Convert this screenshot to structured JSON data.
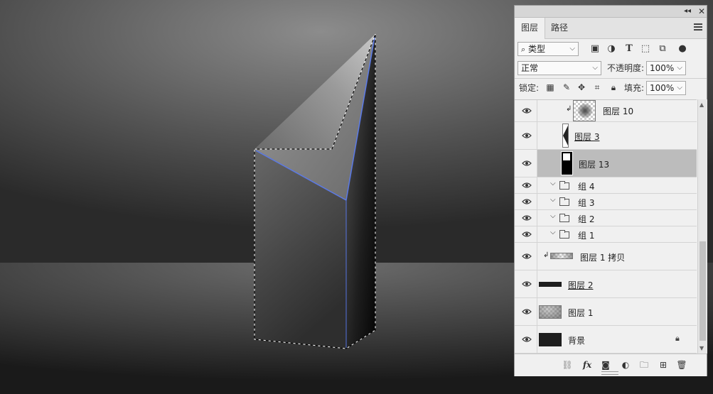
{
  "panel": {
    "tabs": [
      {
        "label": "图层",
        "active": true
      },
      {
        "label": "路径",
        "active": false
      }
    ],
    "titlebar": {
      "collapse_icon": "double-chevron-icon",
      "close_icon": "close-icon"
    },
    "filter": {
      "kind_label": "类型",
      "search_icon": "search-icon"
    },
    "blend": {
      "mode": "正常",
      "opacity_label": "不透明度:",
      "opacity_value": "100%"
    },
    "lock": {
      "label": "锁定:",
      "fill_label": "填充:",
      "fill_value": "100%"
    },
    "layers": [
      {
        "name": "图层 10",
        "kind": "clipped"
      },
      {
        "name": "图层 3",
        "kind": "shape"
      },
      {
        "name": "图层 13",
        "kind": "selected"
      },
      {
        "name": "组 4",
        "kind": "group"
      },
      {
        "name": "组 3",
        "kind": "group"
      },
      {
        "name": "组 2",
        "kind": "group"
      },
      {
        "name": "组 1",
        "kind": "group"
      },
      {
        "name": "图层 1 拷贝",
        "kind": "clipped"
      },
      {
        "name": "图层 2",
        "kind": "bar"
      },
      {
        "name": "图层 1",
        "kind": "checker"
      },
      {
        "name": "背景",
        "kind": "background",
        "locked": true
      }
    ]
  },
  "colors": {
    "panel_bg": "#f0f0f0",
    "selected_row": "#bcbcbc",
    "edge_highlight": "#5b7fff"
  }
}
